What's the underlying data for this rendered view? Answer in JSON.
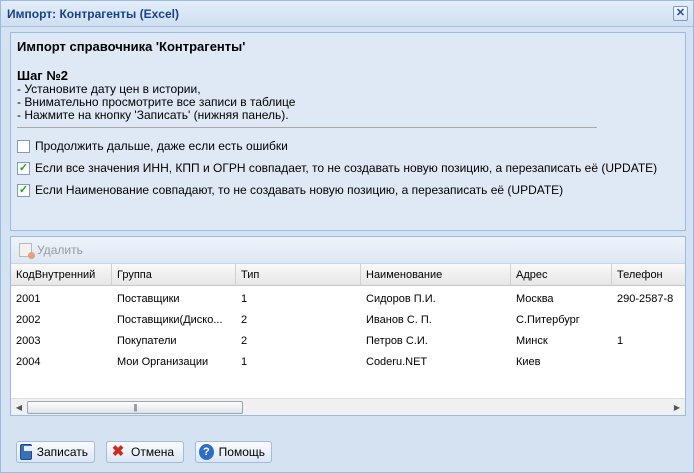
{
  "window": {
    "title": "Импорт: Контрагенты (Excel)",
    "close_glyph": "✕"
  },
  "intro": {
    "heading": "Импорт справочника 'Контрагенты'",
    "step_title": "Шаг №2",
    "instructions": [
      "- Установите дату цен в истории,",
      "- Внимательно просмотрите все записи в таблице",
      "- Нажмите на кнопку 'Записать' (нижняя панель)."
    ]
  },
  "options": [
    {
      "label": "Продолжить дальше, даже если есть ошибки",
      "checked": false,
      "mark": ""
    },
    {
      "label": "Если все значения ИНН, КПП и ОГРН совпадает, то не создавать новую позицию, а перезаписать её (UPDATE)",
      "checked": true,
      "mark": "✓"
    },
    {
      "label": "Если Наименование совпадают, то не создавать новую позицию, а перезаписать её (UPDATE)",
      "checked": true,
      "mark": "✓"
    }
  ],
  "grid": {
    "toolbar": {
      "delete_label": "Удалить",
      "delete_icon": "delete-icon"
    },
    "columns": [
      "КодВнутренний",
      "Группа",
      "Тип",
      "Наименование",
      "Адрес",
      "Телефон"
    ],
    "rows": [
      [
        "2001",
        "Поставщики",
        "1",
        "Сидоров П.И.",
        "Москва",
        "290-2587-8"
      ],
      [
        "2002",
        "Поставщики(Диско...",
        "2",
        "Иванов С. П.",
        "С.Питербург",
        ""
      ],
      [
        "2003",
        "Покупатели",
        "2",
        "Петров С.И.",
        "Минск",
        "1"
      ],
      [
        "2004",
        "Мои Организации",
        "1",
        "Coderu.NET",
        "Киев",
        ""
      ]
    ],
    "scrollbar": {
      "left_arrow": "◀",
      "right_arrow": "▶",
      "thumb_grip": "|||"
    }
  },
  "footer": {
    "save_label": "Записать",
    "cancel_label": "Отмена",
    "help_label": "Помощь",
    "cancel_glyph": "✖",
    "help_glyph": "?"
  }
}
